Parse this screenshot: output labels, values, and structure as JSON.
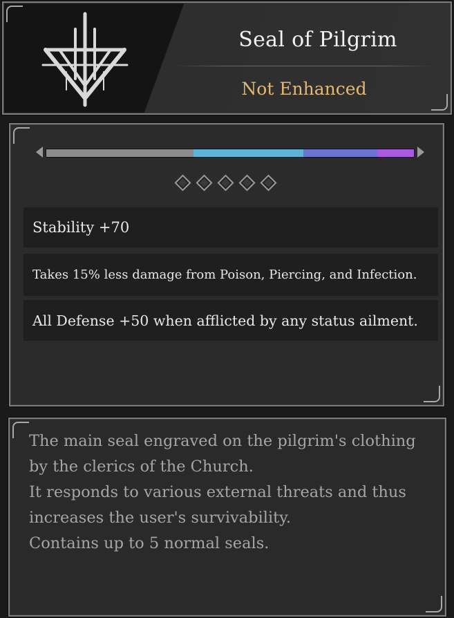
{
  "item": {
    "icon": "pilgrim-seal-emblem-icon",
    "title": "Seal of Pilgrim",
    "status": "Not Enhanced",
    "status_color": "#e3b873"
  },
  "enhancement_bar": {
    "segments": [
      {
        "color": "#8c8c8c",
        "fraction": 0.4
      },
      {
        "color": "#5fb3d6",
        "fraction": 0.3
      },
      {
        "color": "#6a73d0",
        "fraction": 0.2
      },
      {
        "color": "#a95be0",
        "fraction": 0.1
      }
    ]
  },
  "seal_slots": {
    "count": 5,
    "icon": "diamond-slot-icon"
  },
  "stats": [
    "Stability +70",
    "Takes 15% less damage from Poison, Piercing, and Infection.",
    "All Defense +50 when afflicted by any status ailment."
  ],
  "description": [
    "The main seal engraved on the pilgrim's clothing",
    "by the clerics of the Church.",
    "It responds to various external threats and thus",
    "increases the user's survivability.",
    "Contains up to 5 normal seals."
  ]
}
